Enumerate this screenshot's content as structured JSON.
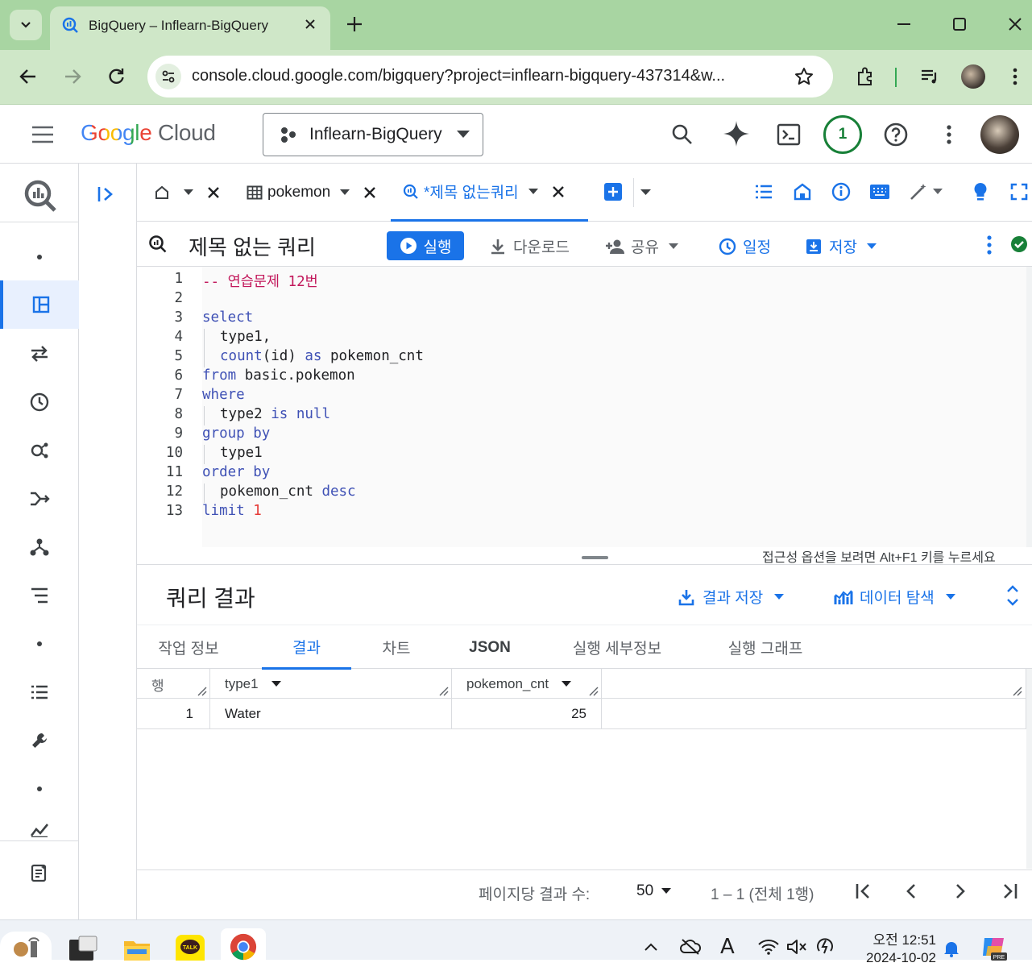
{
  "browser": {
    "tab_title": "BigQuery – Inflearn-BigQuery",
    "url": "console.cloud.google.com/bigquery?project=inflearn-bigquery-437314&w..."
  },
  "gcp": {
    "logo_google": "Google",
    "logo_cloud": "Cloud",
    "project_name": "Inflearn-BigQuery",
    "notification_count": "1"
  },
  "editor_tabs": {
    "table_tab": "pokemon",
    "query_tab": "*제목 없는쿼리"
  },
  "query_toolbar": {
    "title": "제목 없는 쿼리",
    "run": "실행",
    "download": "다운로드",
    "share": "공유",
    "schedule": "일정",
    "save": "저장"
  },
  "editor": {
    "lines": [
      {
        "n": "1"
      },
      {
        "n": "2"
      },
      {
        "n": "3"
      },
      {
        "n": "4"
      },
      {
        "n": "5"
      },
      {
        "n": "6"
      },
      {
        "n": "7"
      },
      {
        "n": "8"
      },
      {
        "n": "9"
      },
      {
        "n": "10"
      },
      {
        "n": "11"
      },
      {
        "n": "12"
      },
      {
        "n": "13"
      }
    ],
    "code": {
      "l1": "-- 연습문제 12번",
      "l3": "select",
      "l4": "type1,",
      "l5a": "count",
      "l5b": "(id) ",
      "l5c": "as",
      "l5d": " pokemon_cnt",
      "l6a": "from",
      "l6b": " basic.pokemon",
      "l7": "where",
      "l8a": "type2 ",
      "l8b": "is",
      "l8c": " null",
      "l9": "group by",
      "l10": "type1",
      "l11": "order by",
      "l12a": "pokemon_cnt ",
      "l12b": "desc",
      "l13a": "limit",
      "l13b": " 1"
    },
    "accessibility_hint": "접근성 옵션을 보려면 Alt+F1 키를 누르세요"
  },
  "results": {
    "title": "쿼리 결과",
    "save_results": "결과 저장",
    "explore_data": "데이터 탐색",
    "tabs": [
      "작업 정보",
      "결과",
      "차트",
      "JSON",
      "실행 세부정보",
      "실행 그래프"
    ],
    "columns": [
      "행",
      "type1",
      "pokemon_cnt"
    ],
    "rows": [
      {
        "row": "1",
        "type1": "Water",
        "pokemon_cnt": "25"
      }
    ]
  },
  "pager": {
    "per_page_label": "페이지당 결과 수:",
    "per_page_value": "50",
    "range": "1 – 1 (전체 1행)"
  },
  "taskbar": {
    "time_period": "오전",
    "time": "12:51",
    "date": "2024-10-02"
  },
  "colors": {
    "chrome_tabstrip": "#a8d5a2",
    "chrome_toolbar": "#cfe7c8",
    "accent_blue": "#1a73e8",
    "run_button": "#1a73e8",
    "status_green": "#188038"
  }
}
